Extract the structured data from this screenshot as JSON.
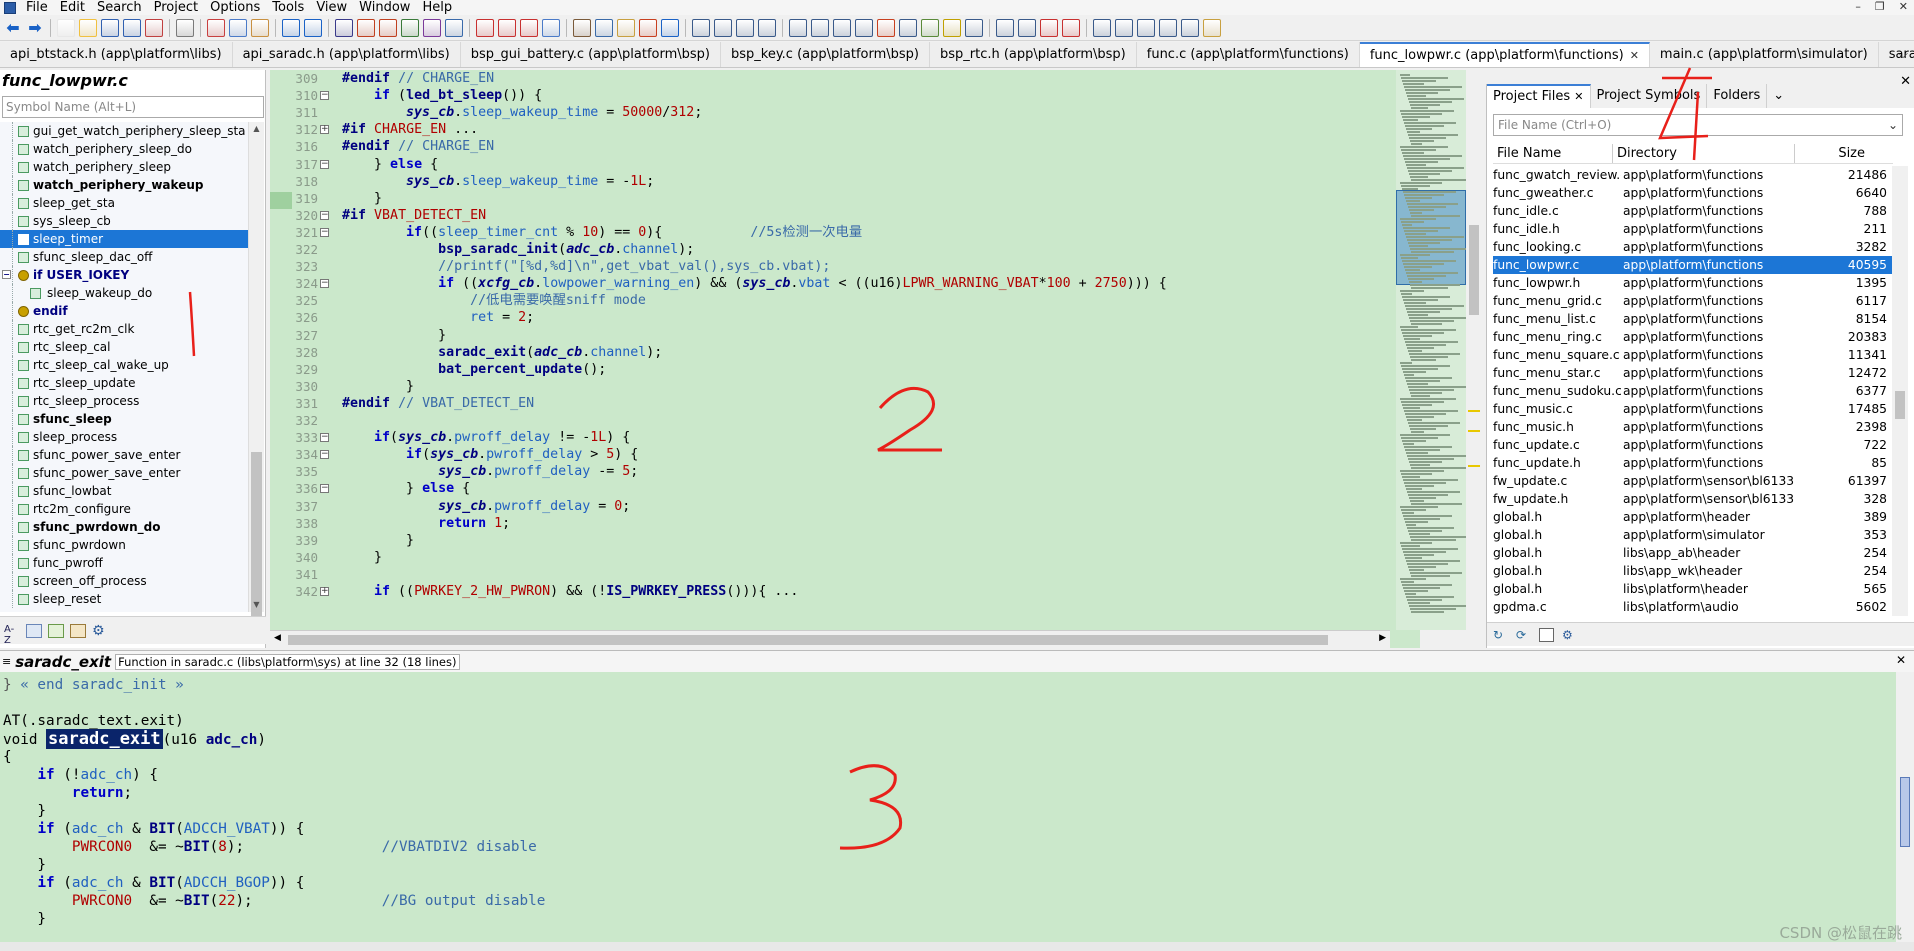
{
  "menu": [
    "File",
    "Edit",
    "Search",
    "Project",
    "Options",
    "Tools",
    "View",
    "Window",
    "Help"
  ],
  "tabs": [
    {
      "label": "api_btstack.h (app\\platform\\libs)",
      "active": false
    },
    {
      "label": "api_saradc.h (app\\platform\\libs)",
      "active": false
    },
    {
      "label": "bsp_gui_battery.c (app\\platform\\bsp)",
      "active": false
    },
    {
      "label": "bsp_key.c (app\\platform\\bsp)",
      "active": false
    },
    {
      "label": "bsp_rtc.h (app\\platform\\bsp)",
      "active": false
    },
    {
      "label": "func.c (app\\platform\\functions)",
      "active": false
    },
    {
      "label": "func_lowpwr.c (app\\platform\\functions)",
      "active": true
    },
    {
      "label": "main.c (app\\platform\\simulator)",
      "active": false
    },
    {
      "label": "saradc.c (libs\\platform\\sys)",
      "active": false
    }
  ],
  "symbols": {
    "title": "func_lowpwr.c",
    "search_placeholder": "Symbol Name (Alt+L)",
    "items": [
      {
        "label": "gui_get_watch_periphery_sleep_sta",
        "bold": false,
        "indent": false,
        "sel": false,
        "pp": false
      },
      {
        "label": "watch_periphery_sleep_do",
        "bold": false,
        "indent": false,
        "sel": false,
        "pp": false
      },
      {
        "label": "watch_periphery_sleep",
        "bold": false,
        "indent": false,
        "sel": false,
        "pp": false
      },
      {
        "label": "watch_periphery_wakeup",
        "bold": true,
        "indent": false,
        "sel": false,
        "pp": false
      },
      {
        "label": "sleep_get_sta",
        "bold": false,
        "indent": false,
        "sel": false,
        "pp": false
      },
      {
        "label": "sys_sleep_cb",
        "bold": false,
        "indent": false,
        "sel": false,
        "pp": false
      },
      {
        "label": "sleep_timer",
        "bold": false,
        "indent": false,
        "sel": true,
        "pp": false
      },
      {
        "label": "sfunc_sleep_dac_off",
        "bold": false,
        "indent": false,
        "sel": false,
        "pp": false
      },
      {
        "label": "if USER_IOKEY",
        "bold": false,
        "indent": false,
        "sel": false,
        "pp": true,
        "expand": true
      },
      {
        "label": "sleep_wakeup_do",
        "bold": false,
        "indent": true,
        "sel": false,
        "pp": false
      },
      {
        "label": "endif",
        "bold": false,
        "indent": false,
        "sel": false,
        "pp": true
      },
      {
        "label": "rtc_get_rc2m_clk",
        "bold": false,
        "indent": false,
        "sel": false,
        "pp": false
      },
      {
        "label": "rtc_sleep_cal",
        "bold": false,
        "indent": false,
        "sel": false,
        "pp": false
      },
      {
        "label": "rtc_sleep_cal_wake_up",
        "bold": false,
        "indent": false,
        "sel": false,
        "pp": false
      },
      {
        "label": "rtc_sleep_update",
        "bold": false,
        "indent": false,
        "sel": false,
        "pp": false
      },
      {
        "label": "rtc_sleep_process",
        "bold": false,
        "indent": false,
        "sel": false,
        "pp": false
      },
      {
        "label": "sfunc_sleep",
        "bold": true,
        "indent": false,
        "sel": false,
        "pp": false
      },
      {
        "label": "sleep_process",
        "bold": false,
        "indent": false,
        "sel": false,
        "pp": false
      },
      {
        "label": "sfunc_power_save_enter",
        "bold": false,
        "indent": false,
        "sel": false,
        "pp": false
      },
      {
        "label": "sfunc_power_save_enter",
        "bold": false,
        "indent": false,
        "sel": false,
        "pp": false
      },
      {
        "label": "sfunc_lowbat",
        "bold": false,
        "indent": false,
        "sel": false,
        "pp": false
      },
      {
        "label": "rtc2m_configure",
        "bold": false,
        "indent": false,
        "sel": false,
        "pp": false
      },
      {
        "label": "sfunc_pwrdown_do",
        "bold": true,
        "indent": false,
        "sel": false,
        "pp": false
      },
      {
        "label": "sfunc_pwrdown",
        "bold": false,
        "indent": false,
        "sel": false,
        "pp": false
      },
      {
        "label": "func_pwroff",
        "bold": false,
        "indent": false,
        "sel": false,
        "pp": false
      },
      {
        "label": "screen_off_process",
        "bold": false,
        "indent": false,
        "sel": false,
        "pp": false
      },
      {
        "label": "sleep_reset",
        "bold": false,
        "indent": false,
        "sel": false,
        "pp": false
      }
    ]
  },
  "editor": {
    "lines": [
      {
        "n": "309",
        "fold": "",
        "h": "<span class='pp'>#endif</span> <span class='cm'>// CHARGE_EN</span>"
      },
      {
        "n": "310",
        "fold": "-",
        "h": "    <span class='kw'>if</span> (<span class='fn'>led_bt_sleep</span>()) {"
      },
      {
        "n": "311",
        "fold": "",
        "h": "        <span class='var'>sys_cb</span>.<span class='mem'>sleep_wakeup_time</span> = <span class='num'>50000</span>/<span class='num'>312</span>;"
      },
      {
        "n": "312",
        "fold": "+",
        "h": "<span class='pp'>#if</span> <span class='mac'>CHARGE_EN</span> ..."
      },
      {
        "n": "316",
        "fold": "",
        "h": "<span class='pp'>#endif</span> <span class='cm'>// CHARGE_EN</span>"
      },
      {
        "n": "317",
        "fold": "-",
        "h": "    } <span class='kw'>else</span> {"
      },
      {
        "n": "318",
        "fold": "",
        "h": "        <span class='var'>sys_cb</span>.<span class='mem'>sleep_wakeup_time</span> = -<span class='num'>1L</span>;"
      },
      {
        "n": "319",
        "fold": "",
        "h": "    }"
      },
      {
        "n": "320",
        "fold": "-",
        "h": "<span class='pp'>#if</span> <span class='mac'>VBAT_DETECT_EN</span>"
      },
      {
        "n": "321",
        "fold": "-",
        "h": "        <span class='kw'>if</span>((<span class='mem'>sleep_timer_cnt</span> % <span class='num'>10</span>) == <span class='num'>0</span>){           <span class='cm'>//5s检测一次电量</span>"
      },
      {
        "n": "322",
        "fold": "",
        "h": "            <span class='fn'>bsp_saradc_init</span>(<span class='var'>adc_cb</span>.<span class='mem'>channel</span>);"
      },
      {
        "n": "323",
        "fold": "",
        "h": "            <span class='cm'>//printf(\"[%d,%d]\\n\",get_vbat_val(),sys_cb.vbat);</span>"
      },
      {
        "n": "324",
        "fold": "-",
        "h": "            <span class='kw'>if</span> ((<span class='var'>xcfg_cb</span>.<span class='mem'>lowpower_warning_en</span>) && (<span class='var'>sys_cb</span>.<span class='mem'>vbat</span> < ((u16)<span class='mac'>LPWR_WARNING_VBAT</span>*<span class='num'>100</span> + <span class='num'>2750</span>))) {"
      },
      {
        "n": "325",
        "fold": "",
        "h": "                <span class='cm'>//低电需要唤醒sniff mode</span>"
      },
      {
        "n": "326",
        "fold": "",
        "h": "                <span class='mem'>ret</span> = <span class='num'>2</span>;"
      },
      {
        "n": "327",
        "fold": "",
        "h": "            }"
      },
      {
        "n": "328",
        "fold": "",
        "h": "            <span class='fn'>saradc_exit</span>(<span class='var'>adc_cb</span>.<span class='mem'>channel</span>);"
      },
      {
        "n": "329",
        "fold": "",
        "h": "            <span class='fn'>bat_percent_update</span>();"
      },
      {
        "n": "330",
        "fold": "",
        "h": "        }"
      },
      {
        "n": "331",
        "fold": "",
        "h": "<span class='pp'>#endif</span> <span class='cm'>// VBAT_DETECT_EN</span>"
      },
      {
        "n": "332",
        "fold": "",
        "h": ""
      },
      {
        "n": "333",
        "fold": "-",
        "h": "    <span class='kw'>if</span>(<span class='var'>sys_cb</span>.<span class='mem'>pwroff_delay</span> != -<span class='num'>1L</span>) {"
      },
      {
        "n": "334",
        "fold": "-",
        "h": "        <span class='kw'>if</span>(<span class='var'>sys_cb</span>.<span class='mem'>pwroff_delay</span> > <span class='num'>5</span>) {"
      },
      {
        "n": "335",
        "fold": "",
        "h": "            <span class='var'>sys_cb</span>.<span class='mem'>pwroff_delay</span> -= <span class='num'>5</span>;"
      },
      {
        "n": "336",
        "fold": "-",
        "h": "        } <span class='kw'>else</span> {"
      },
      {
        "n": "337",
        "fold": "",
        "h": "            <span class='var'>sys_cb</span>.<span class='mem'>pwroff_delay</span> = <span class='num'>0</span>;"
      },
      {
        "n": "338",
        "fold": "",
        "h": "            <span class='kw'>return</span> <span class='num'>1</span>;"
      },
      {
        "n": "339",
        "fold": "",
        "h": "        }"
      },
      {
        "n": "340",
        "fold": "",
        "h": "    }"
      },
      {
        "n": "341",
        "fold": "",
        "h": ""
      },
      {
        "n": "342",
        "fold": "+",
        "h": "    <span class='kw'>if</span> ((<span class='mac'>PWRKEY_2_HW_PWRON</span>) && (!<span class='fn'>IS_PWRKEY_PRESS</span>())){ ..."
      }
    ]
  },
  "project": {
    "tabs": [
      "Project Files",
      "Project Symbols",
      "Folders"
    ],
    "search_placeholder": "File Name (Ctrl+O)",
    "columns": [
      "File Name",
      "Directory",
      "Size"
    ],
    "files": [
      {
        "name": "func_gwatch_review.c",
        "dir": "app\\platform\\functions",
        "size": "21486",
        "sel": false
      },
      {
        "name": "func_gweather.c",
        "dir": "app\\platform\\functions",
        "size": "6640",
        "sel": false
      },
      {
        "name": "func_idle.c",
        "dir": "app\\platform\\functions",
        "size": "788",
        "sel": false
      },
      {
        "name": "func_idle.h",
        "dir": "app\\platform\\functions",
        "size": "211",
        "sel": false
      },
      {
        "name": "func_looking.c",
        "dir": "app\\platform\\functions",
        "size": "3282",
        "sel": false
      },
      {
        "name": "func_lowpwr.c",
        "dir": "app\\platform\\functions",
        "size": "40595",
        "sel": true
      },
      {
        "name": "func_lowpwr.h",
        "dir": "app\\platform\\functions",
        "size": "1395",
        "sel": false
      },
      {
        "name": "func_menu_grid.c",
        "dir": "app\\platform\\functions",
        "size": "6117",
        "sel": false
      },
      {
        "name": "func_menu_list.c",
        "dir": "app\\platform\\functions",
        "size": "8154",
        "sel": false
      },
      {
        "name": "func_menu_ring.c",
        "dir": "app\\platform\\functions",
        "size": "20383",
        "sel": false
      },
      {
        "name": "func_menu_square.c",
        "dir": "app\\platform\\functions",
        "size": "11341",
        "sel": false
      },
      {
        "name": "func_menu_star.c",
        "dir": "app\\platform\\functions",
        "size": "12472",
        "sel": false
      },
      {
        "name": "func_menu_sudoku.c",
        "dir": "app\\platform\\functions",
        "size": "6377",
        "sel": false
      },
      {
        "name": "func_music.c",
        "dir": "app\\platform\\functions",
        "size": "17485",
        "sel": false
      },
      {
        "name": "func_music.h",
        "dir": "app\\platform\\functions",
        "size": "2398",
        "sel": false
      },
      {
        "name": "func_update.c",
        "dir": "app\\platform\\functions",
        "size": "722",
        "sel": false
      },
      {
        "name": "func_update.h",
        "dir": "app\\platform\\functions",
        "size": "85",
        "sel": false
      },
      {
        "name": "fw_update.c",
        "dir": "app\\platform\\sensor\\bl6133",
        "size": "61397",
        "sel": false
      },
      {
        "name": "fw_update.h",
        "dir": "app\\platform\\sensor\\bl6133",
        "size": "328",
        "sel": false
      },
      {
        "name": "global.h",
        "dir": "app\\platform\\header",
        "size": "389",
        "sel": false
      },
      {
        "name": "global.h",
        "dir": "app\\platform\\simulator",
        "size": "353",
        "sel": false
      },
      {
        "name": "global.h",
        "dir": "libs\\app_ab\\header",
        "size": "254",
        "sel": false
      },
      {
        "name": "global.h",
        "dir": "libs\\app_wk\\header",
        "size": "254",
        "sel": false
      },
      {
        "name": "global.h",
        "dir": "libs\\platform\\header",
        "size": "565",
        "sel": false
      },
      {
        "name": "gpdma.c",
        "dir": "libs\\platform\\audio",
        "size": "5602",
        "sel": false
      }
    ]
  },
  "context": {
    "title": "saradc_exit",
    "desc": "Function in saradc.c (libs\\platform\\sys) at line 32 (18 lines)",
    "lines": [
      {
        "h": "} <span class='cm'>« end saradc_init »</span>",
        "c": "#555"
      },
      {
        "h": "",
        "c": ""
      },
      {
        "h": "AT(.saradc_text.exit)",
        "c": ""
      },
      {
        "h": "void <span class='selword'>saradc_exit</span>(u16 <span class='fn'>adc_ch</span>)",
        "c": ""
      },
      {
        "h": "{",
        "c": ""
      },
      {
        "h": "    <span class='kw'>if</span> (!<span class='mem'>adc_ch</span>) {",
        "c": ""
      },
      {
        "h": "        <span class='kw'>return</span>;",
        "c": ""
      },
      {
        "h": "    }",
        "c": ""
      },
      {
        "h": "    <span class='kw'>if</span> (<span class='mem'>adc_ch</span> & <span class='fn'>BIT</span>(<span class='mem'>ADCCH_VBAT</span>)) {",
        "c": ""
      },
      {
        "h": "        <span class='mac'>PWRCON0</span>  &= ~<span class='fn'>BIT</span>(<span class='num'>8</span>);                <span class='cm'>//VBATDIV2 disable</span>",
        "c": ""
      },
      {
        "h": "    }",
        "c": ""
      },
      {
        "h": "    <span class='kw'>if</span> (<span class='mem'>adc_ch</span> & <span class='fn'>BIT</span>(<span class='mem'>ADCCH_BGOP</span>)) {",
        "c": ""
      },
      {
        "h": "        <span class='mac'>PWRCON0</span>  &= ~<span class='fn'>BIT</span>(<span class='num'>22</span>);               <span class='cm'>//BG output disable</span>",
        "c": ""
      },
      {
        "h": "    }",
        "c": ""
      }
    ]
  },
  "watermark": "CSDN @松鼠在跳",
  "annotations": [
    "1",
    "2",
    "3",
    "4"
  ],
  "colors": {
    "editor_bg": "#cbe8cb",
    "selection": "#1c76d6",
    "anno": "#e8201a"
  }
}
